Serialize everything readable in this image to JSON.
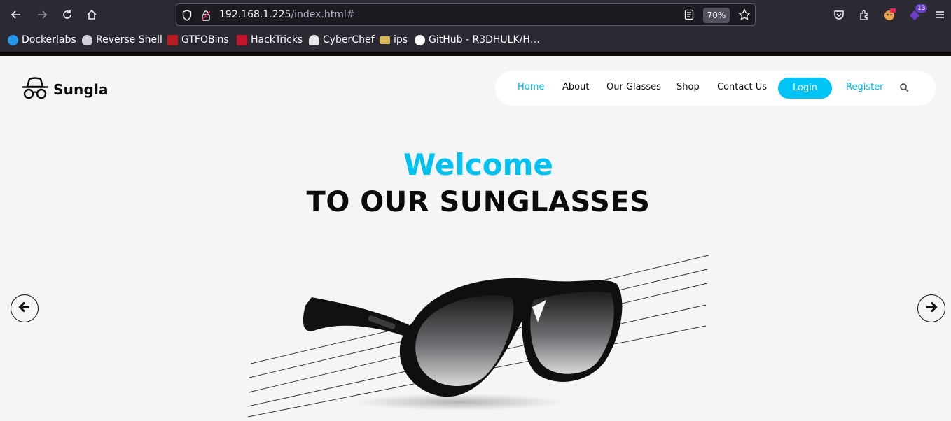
{
  "browser": {
    "url_host": "192.168.1.225",
    "url_path": "/index.html#",
    "zoom": "70%",
    "extension_badge": "13",
    "bookmarks": [
      {
        "label": "Dockerlabs",
        "icon": "whale-icon",
        "color": "#2496ed"
      },
      {
        "label": "Reverse Shell",
        "icon": "skull-icon",
        "color": "#cfcfd6"
      },
      {
        "label": "GTFOBins",
        "icon": "gtfobins-icon",
        "color": "#b81d24"
      },
      {
        "label": "HackTricks",
        "icon": "hacktricks-icon",
        "color": "#c4162a"
      },
      {
        "label": "CyberChef",
        "icon": "chef-hat-icon",
        "color": "#e8e8ea"
      },
      {
        "label": "ips",
        "icon": "folder-icon",
        "color": "#d8b75a"
      },
      {
        "label": "GitHub - R3DHULK/H…",
        "icon": "github-icon",
        "color": "#ffffff"
      }
    ]
  },
  "site": {
    "logo": "Sungla",
    "nav": {
      "home": "Home",
      "about": "About",
      "our_glasses": "Our Glasses",
      "shop": "Shop",
      "contact": "Contact Us",
      "login": "Login",
      "register": "Register"
    },
    "hero": {
      "welcome": "Welcome",
      "tagline": "TO OUR SUNGLASSES"
    },
    "colors": {
      "accent": "#00c2f2",
      "text": "#0b0b0b",
      "background": "#f4f5f4"
    }
  }
}
